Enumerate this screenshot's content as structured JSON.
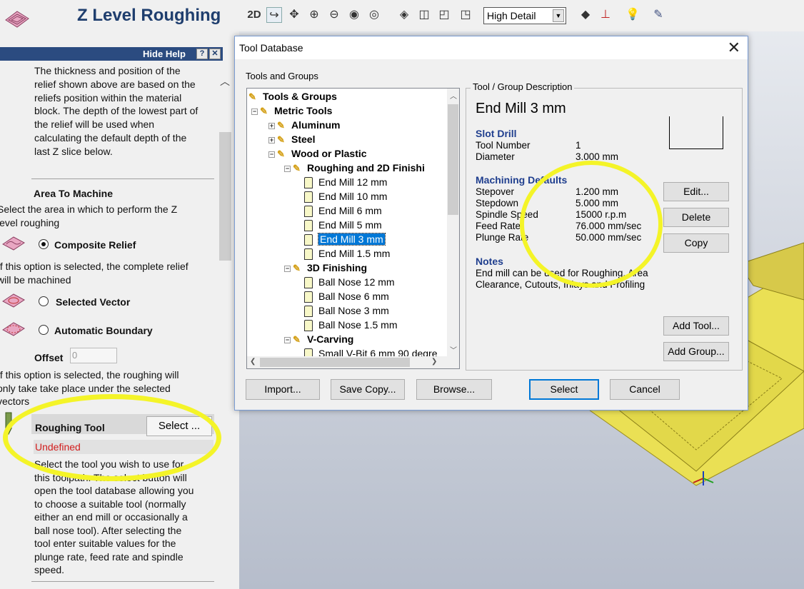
{
  "left_panel": {
    "title": "Z Level Roughing",
    "help_bar_label": "Hide Help",
    "help_question": "?",
    "help_close": "✕",
    "help_text_lines": [
      "The thickness and position of the",
      "relief shown above are based on the",
      "reliefs position within the material",
      "block. The depth of the lowest part of",
      "the relief will be used when",
      "calculating the default depth of the",
      "last Z slice below."
    ],
    "area_heading": "Area To Machine",
    "area_desc_lines": [
      "Select the area in which to perform the Z",
      "level roughing"
    ],
    "opt_composite": "Composite Relief",
    "composite_desc_lines": [
      "If this option is selected, the complete relief",
      "will be machined"
    ],
    "opt_selected_vector": "Selected Vector",
    "opt_auto_boundary": "Automatic Boundary",
    "offset_label": "Offset",
    "offset_value": "0",
    "offset_desc_lines": [
      "If this option is selected, the roughing will",
      "only take take place under the selected",
      "vectors"
    ],
    "roughing_tool_label": "Roughing Tool",
    "select_button": "Select ...",
    "undefined_label": "Undefined",
    "tool_desc_lines": [
      "Select the tool you wish to use for",
      "this toolpath. The select button will",
      "open the tool database allowing you",
      "to choose a suitable tool (normally",
      "either an end mill or occasionally a",
      "ball nose tool). After selecting the",
      "tool enter suitable values for the",
      "plunge rate, feed rate and spindle",
      "speed."
    ]
  },
  "toolbar": {
    "view_2d": "2D",
    "detail_select": "High Detail"
  },
  "dialog": {
    "title": "Tool Database",
    "close": "✕",
    "tools_groups_label": "Tools and Groups",
    "tree": [
      {
        "label": "Tools & Groups",
        "type": "group",
        "level": 0,
        "exp": ""
      },
      {
        "label": "Metric Tools",
        "type": "group",
        "level": 1,
        "exp": "−"
      },
      {
        "label": "Aluminum",
        "type": "group",
        "level": 2,
        "exp": "+"
      },
      {
        "label": "Steel",
        "type": "group",
        "level": 2,
        "exp": "+"
      },
      {
        "label": "Wood or Plastic",
        "type": "group",
        "level": 2,
        "exp": "−"
      },
      {
        "label": "Roughing and 2D Finishi",
        "type": "group",
        "level": 3,
        "exp": "−"
      },
      {
        "label": "End Mill 12 mm",
        "type": "tool",
        "level": 4
      },
      {
        "label": "End Mill 10 mm",
        "type": "tool",
        "level": 4
      },
      {
        "label": "End Mill 6 mm",
        "type": "tool",
        "level": 4
      },
      {
        "label": "End Mill 5 mm",
        "type": "tool",
        "level": 4
      },
      {
        "label": "End Mill 3 mm",
        "type": "tool",
        "level": 4,
        "selected": true
      },
      {
        "label": "End Mill 1.5 mm",
        "type": "tool",
        "level": 4
      },
      {
        "label": "3D Finishing",
        "type": "group",
        "level": 3,
        "exp": "−"
      },
      {
        "label": "Ball Nose 12 mm",
        "type": "tool",
        "level": 4
      },
      {
        "label": "Ball Nose 6 mm",
        "type": "tool",
        "level": 4
      },
      {
        "label": "Ball Nose 3 mm",
        "type": "tool",
        "level": 4
      },
      {
        "label": "Ball Nose 1.5 mm",
        "type": "tool",
        "level": 4
      },
      {
        "label": "V-Carving",
        "type": "group",
        "level": 3,
        "exp": "−"
      },
      {
        "label": "Small V-Bit 6 mm 90 degre",
        "type": "tool",
        "level": 4
      }
    ],
    "desc_legend": "Tool / Group Description",
    "tool_name": "End Mill 3 mm",
    "tool_type": "Slot Drill",
    "tool_number_label": "Tool Number",
    "tool_number_value": "1",
    "diameter_label": "Diameter",
    "diameter_value": "3.000 mm",
    "machining_heading": "Machining Defaults",
    "stepover_label": "Stepover",
    "stepover_value": "1.200 mm",
    "stepdown_label": "Stepdown",
    "stepdown_value": "5.000 mm",
    "spindle_label": "Spindle Speed",
    "spindle_value": "15000 r.p.m",
    "feed_label": "Feed Rate",
    "feed_value": "76.000 mm/sec",
    "plunge_label": "Plunge Rate",
    "plunge_value": "50.000 mm/sec",
    "notes_heading": "Notes",
    "notes_lines": [
      "End mill can be used for Roughing, Area",
      "Clearance, Cutouts, Inlays and Profiling"
    ],
    "btn_edit": "Edit...",
    "btn_delete": "Delete",
    "btn_copy": "Copy",
    "btn_add_tool": "Add Tool...",
    "btn_add_group": "Add Group...",
    "btn_import": "Import...",
    "btn_save_copy": "Save Copy...",
    "btn_browse": "Browse...",
    "btn_select": "Select",
    "btn_cancel": "Cancel"
  },
  "colors": {
    "highlight": "#f4f428",
    "title_blue": "#1f3e6e",
    "undefined_red": "#d21d1d",
    "selection_blue": "#0078d7",
    "model_yellow": "#eae054"
  }
}
